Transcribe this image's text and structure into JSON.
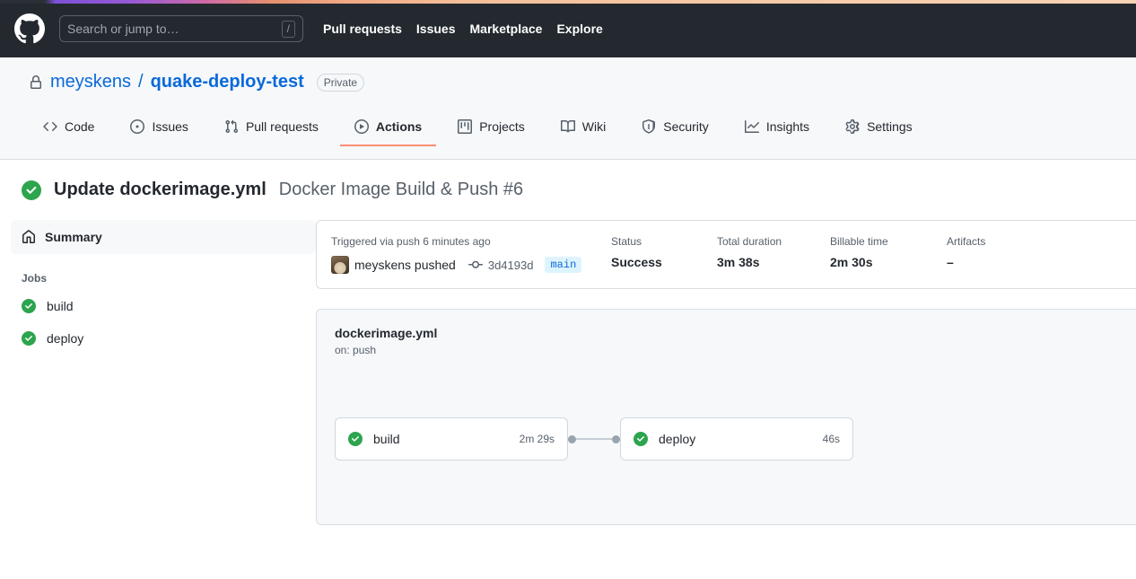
{
  "header": {
    "logo_icon": "github-mark-icon",
    "search": {
      "placeholder": "Search or jump to…",
      "shortcut_key": "/"
    },
    "nav": [
      {
        "label": "Pull requests"
      },
      {
        "label": "Issues"
      },
      {
        "label": "Marketplace"
      },
      {
        "label": "Explore"
      }
    ]
  },
  "repo": {
    "visibility_icon": "lock-icon",
    "owner": "meyskens",
    "separator": "/",
    "name": "quake-deploy-test",
    "visibility_badge": "Private",
    "tabs": [
      {
        "label": "Code",
        "icon": "code-icon",
        "active": false
      },
      {
        "label": "Issues",
        "icon": "issue-opened-icon",
        "active": false
      },
      {
        "label": "Pull requests",
        "icon": "git-pull-request-icon",
        "active": false
      },
      {
        "label": "Actions",
        "icon": "play-icon",
        "active": true
      },
      {
        "label": "Projects",
        "icon": "project-icon",
        "active": false
      },
      {
        "label": "Wiki",
        "icon": "book-icon",
        "active": false
      },
      {
        "label": "Security",
        "icon": "shield-icon",
        "active": false
      },
      {
        "label": "Insights",
        "icon": "graph-icon",
        "active": false
      },
      {
        "label": "Settings",
        "icon": "gear-icon",
        "active": false
      }
    ]
  },
  "run": {
    "status_icon": "check-circle-fill-icon",
    "title": "Update dockerimage.yml",
    "workflow_label": "Docker Image Build & Push #6"
  },
  "sidebar": {
    "summary_label": "Summary",
    "summary_icon": "home-icon",
    "jobs_heading": "Jobs",
    "jobs": [
      {
        "name": "build",
        "status_icon": "check-circle-fill-icon"
      },
      {
        "name": "deploy",
        "status_icon": "check-circle-fill-icon"
      }
    ]
  },
  "summary_panel": {
    "trigger_text": "Triggered via push 6 minutes ago",
    "actor": "meyskens pushed",
    "commit_icon": "git-commit-icon",
    "commit_sha": "3d4193d",
    "branch": "main",
    "stats": [
      {
        "label": "Status",
        "value": "Success"
      },
      {
        "label": "Total duration",
        "value": "3m 38s"
      },
      {
        "label": "Billable time",
        "value": "2m 30s"
      },
      {
        "label": "Artifacts",
        "value": "–"
      }
    ]
  },
  "workflow_graph": {
    "file": "dockerimage.yml",
    "trigger": "on: push",
    "nodes": [
      {
        "name": "build",
        "duration": "2m 29s",
        "status_icon": "check-circle-fill-icon"
      },
      {
        "name": "deploy",
        "duration": "46s",
        "status_icon": "check-circle-fill-icon"
      }
    ]
  },
  "colors": {
    "accent_blue": "#0969da",
    "success_green": "#2da44e",
    "active_tab_underline": "#fd8c73",
    "header_bg": "#24292f",
    "panel_bg": "#f6f8fa",
    "border": "#d8dee4"
  }
}
